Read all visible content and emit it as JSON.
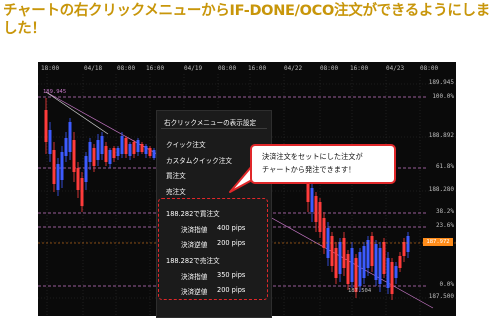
{
  "headline": "チャートの右クリックメニューからIF-DONE/OCO注文ができるようにしました！",
  "chart": {
    "time_labels": [
      "18:00",
      "04/18",
      "08:00",
      "16:00",
      "04/19",
      "08:00",
      "16:00",
      "04/22",
      "08:00",
      "16:00",
      "04/23",
      "08:00"
    ],
    "price_labels": [
      "189.945",
      "188.892",
      "188.280",
      "187.972",
      "187.500"
    ],
    "fib_labels": [
      "100.0%",
      "61.8%",
      "38.2%",
      "23.6%",
      "0.0%"
    ],
    "left_price_label": "189.945",
    "low_label": "187.504",
    "current_price": "187.972",
    "colors": {
      "bull": "#3c5bff",
      "bear": "#ff3b3b",
      "fib_line": "#c878c8",
      "grid": "#2e2e2e"
    }
  },
  "context_menu": {
    "title": "右クリックメニューの表示設定",
    "items": [
      "クイック注文",
      "カスタムクイック注文",
      "買注文",
      "売注文"
    ],
    "ifdone_buy": {
      "header": "188.282で買注文",
      "limit_label": "決済指値",
      "limit_value": "400 pips",
      "stop_label": "決済逆値",
      "stop_value": "200 pips"
    },
    "ifdone_sell": {
      "header": "188.282で売注文",
      "limit_label": "決済指値",
      "limit_value": "350 pips",
      "stop_label": "決済逆値",
      "stop_value": "200 pips"
    }
  },
  "callout": {
    "line1": "決済注文をセットにした注文が",
    "line2": "チャートから発注できます！"
  }
}
